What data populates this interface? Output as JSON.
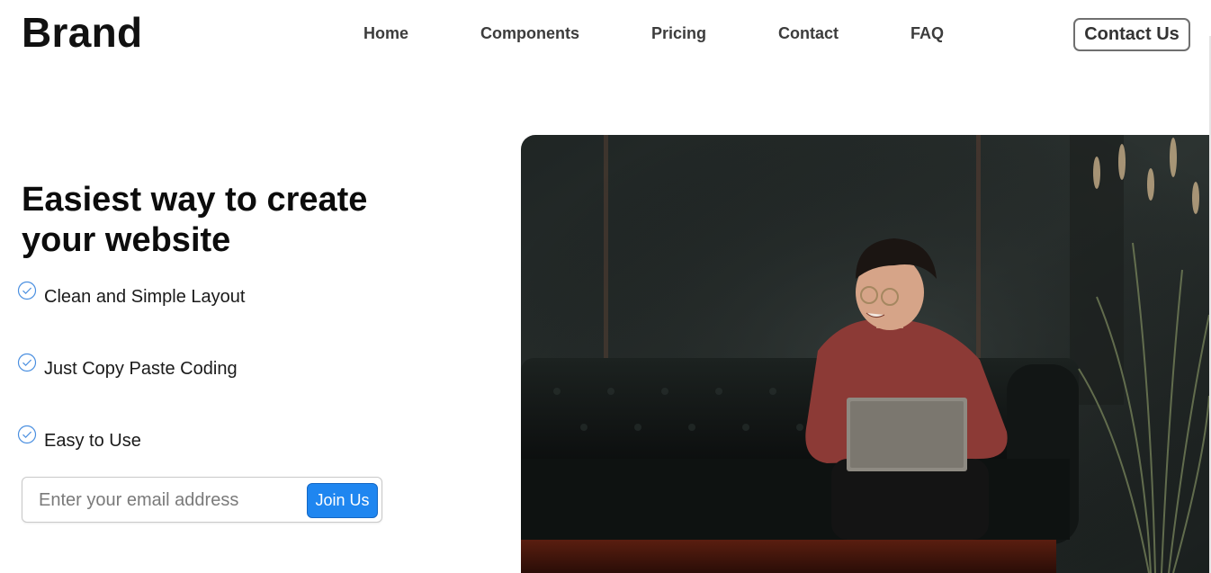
{
  "header": {
    "brand": "Brand",
    "nav": [
      {
        "label": "Home"
      },
      {
        "label": "Components"
      },
      {
        "label": "Pricing"
      },
      {
        "label": "Contact"
      },
      {
        "label": "FAQ"
      }
    ],
    "cta_label": "Contact Us"
  },
  "hero": {
    "title": "Easiest way to create your website",
    "features": [
      {
        "icon": "check-circle-icon",
        "label": "Clean and Simple Layout"
      },
      {
        "icon": "check-circle-icon",
        "label": "Just Copy Paste Coding"
      },
      {
        "icon": "check-circle-icon",
        "label": "Easy to Use"
      }
    ],
    "signup": {
      "email_placeholder": "Enter your email address",
      "button_label": "Join Us"
    }
  },
  "colors": {
    "accent": "#1f86f0",
    "check": "#4a8fe0",
    "text": "#111111"
  }
}
